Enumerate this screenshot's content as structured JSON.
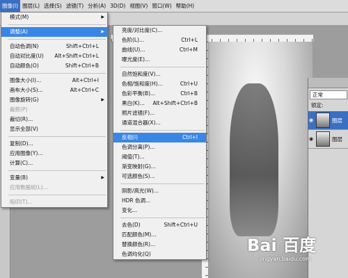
{
  "menubar": {
    "items": [
      "图像(I)",
      "图层(L)",
      "选择(S)",
      "滤镜(T)",
      "分析(A)",
      "3D(D)",
      "视图(V)",
      "窗口(W)",
      "帮助(H)"
    ]
  },
  "image_menu": {
    "items": [
      {
        "label": "模式(M)",
        "shortcut": "",
        "submenu": true
      },
      {
        "sep": true
      },
      {
        "label": "调整(A)",
        "shortcut": "",
        "submenu": true,
        "highlighted": true
      },
      {
        "sep": true
      },
      {
        "label": "自动色调(N)",
        "shortcut": "Shift+Ctrl+L"
      },
      {
        "label": "自动对比度(U)",
        "shortcut": "Alt+Shift+Ctrl+L"
      },
      {
        "label": "自动颜色(O)",
        "shortcut": "Shift+Ctrl+B"
      },
      {
        "sep": true
      },
      {
        "label": "图像大小(I)...",
        "shortcut": "Alt+Ctrl+I"
      },
      {
        "label": "画布大小(S)...",
        "shortcut": "Alt+Ctrl+C"
      },
      {
        "label": "图像旋转(G)",
        "shortcut": "",
        "submenu": true
      },
      {
        "label": "裁剪(P)",
        "shortcut": "",
        "disabled": true
      },
      {
        "label": "裁切(R)...",
        "shortcut": ""
      },
      {
        "label": "显示全部(V)",
        "shortcut": ""
      },
      {
        "sep": true
      },
      {
        "label": "复制(D)...",
        "shortcut": ""
      },
      {
        "label": "应用图像(Y)...",
        "shortcut": ""
      },
      {
        "label": "计算(C)...",
        "shortcut": ""
      },
      {
        "sep": true
      },
      {
        "label": "变量(B)",
        "shortcut": "",
        "submenu": true
      },
      {
        "label": "应用数据组(L)...",
        "shortcut": "",
        "disabled": true
      },
      {
        "sep": true
      },
      {
        "label": "陷印(T)...",
        "shortcut": "",
        "disabled": true
      }
    ]
  },
  "adjust_menu": {
    "items": [
      {
        "label": "亮度/对比度(C)...",
        "shortcut": ""
      },
      {
        "label": "色阶(L)...",
        "shortcut": "Ctrl+L"
      },
      {
        "label": "曲线(U)...",
        "shortcut": "Ctrl+M"
      },
      {
        "label": "曝光度(E)...",
        "shortcut": ""
      },
      {
        "sep": true
      },
      {
        "label": "自然饱和度(V)...",
        "shortcut": ""
      },
      {
        "label": "色相/饱和度(H)...",
        "shortcut": "Ctrl+U"
      },
      {
        "label": "色彩平衡(B)...",
        "shortcut": "Ctrl+B"
      },
      {
        "label": "黑白(K)...",
        "shortcut": "Alt+Shift+Ctrl+B"
      },
      {
        "label": "照片滤镜(F)...",
        "shortcut": ""
      },
      {
        "label": "通道混合器(X)...",
        "shortcut": ""
      },
      {
        "sep": true
      },
      {
        "label": "反相(I)",
        "shortcut": "Ctrl+I",
        "highlighted": true
      },
      {
        "label": "色调分离(P)...",
        "shortcut": ""
      },
      {
        "label": "阈值(T)...",
        "shortcut": ""
      },
      {
        "label": "渐变映射(G)...",
        "shortcut": ""
      },
      {
        "label": "可选颜色(S)...",
        "shortcut": ""
      },
      {
        "sep": true
      },
      {
        "label": "阴影/高光(W)...",
        "shortcut": ""
      },
      {
        "label": "HDR 色调...",
        "shortcut": ""
      },
      {
        "label": "变化...",
        "shortcut": ""
      },
      {
        "sep": true
      },
      {
        "label": "去色(D)",
        "shortcut": "Shift+Ctrl+U"
      },
      {
        "label": "匹配颜色(M)...",
        "shortcut": ""
      },
      {
        "label": "替换颜色(R)...",
        "shortcut": ""
      },
      {
        "label": "色调均化(Q)",
        "shortcut": ""
      }
    ]
  },
  "layers_panel": {
    "blend_mode": "正常",
    "lock_label": "锁定:",
    "layers": [
      {
        "name": "图层",
        "selected": true
      },
      {
        "name": "图层",
        "selected": false
      }
    ]
  },
  "watermark": {
    "logo": "Bai 百度",
    "url": "jingyan.baidu.com"
  },
  "colors": {
    "highlight": "#3a86e6",
    "menubar_active": "#3b6fc4"
  }
}
